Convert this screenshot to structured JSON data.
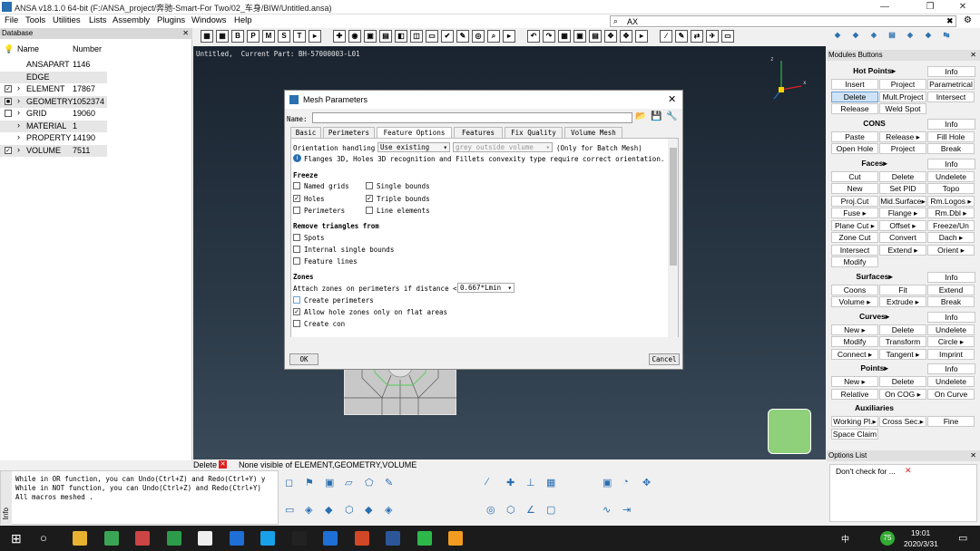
{
  "titlebar": {
    "title": "ANSA v18.1.0 64-bit (F:/ANSA_project/奔驰-Smart-For Two/02_车身/BIW/Untitled.ansa)"
  },
  "menu": [
    "File",
    "Tools",
    "Utilities",
    "Lists",
    "Assembly",
    "Plugins",
    "Windows",
    "Help"
  ],
  "search": {
    "value": "AX"
  },
  "database": {
    "header": "Database",
    "col_name": "Name",
    "col_number": "Number",
    "rows": [
      {
        "name": "ANSAPART",
        "number": "1146",
        "check": ""
      },
      {
        "name": "EDGE",
        "number": "",
        "check": ""
      },
      {
        "name": "ELEMENT",
        "number": "17867",
        "check": "✓"
      },
      {
        "name": "GEOMETRY",
        "number": "1052374",
        "check": "■"
      },
      {
        "name": "GRID",
        "number": "19060",
        "check": " "
      },
      {
        "name": "MATERIAL",
        "number": "1",
        "check": ""
      },
      {
        "name": "PROPERTY",
        "number": "14190",
        "check": ""
      },
      {
        "name": "VOLUME",
        "number": "7511",
        "check": "✓"
      }
    ]
  },
  "viewport": {
    "info": "Untitled,  Current Part: BH-57000003-L01"
  },
  "modules": {
    "header": "Modules Buttons",
    "groups": [
      {
        "title": "Hot Points▸",
        "info": "Info",
        "buttons": [
          [
            "Insert",
            "Project",
            "Parametrical"
          ],
          [
            "Delete",
            "Mult.Project",
            "Intersect"
          ],
          [
            "Release",
            "Weld Spot",
            ""
          ]
        ]
      },
      {
        "title": "CONS",
        "info": "Info",
        "buttons": [
          [
            "Paste",
            "Release ▸",
            "Fill Hole"
          ],
          [
            "Open Hole",
            "Project",
            "Break"
          ]
        ]
      },
      {
        "title": "Faces▸",
        "info": "Info",
        "buttons": [
          [
            "Cut",
            "Delete",
            "Undelete"
          ],
          [
            "New",
            "Set PID",
            "Topo"
          ],
          [
            "Proj.Cut",
            "Mid.Surface▸",
            "Rm.Logos ▸"
          ],
          [
            "Fuse ▸",
            "Flange ▸",
            "Rm.Dbl ▸"
          ],
          [
            "Plane Cut ▸",
            "Offset ▸",
            "Freeze/Un"
          ],
          [
            "Zone Cut",
            "Convert",
            "Dach ▸"
          ],
          [
            "Intersect",
            "Extend ▸",
            "Orient ▸"
          ],
          [
            "Modify",
            "",
            ""
          ]
        ]
      },
      {
        "title": "Surfaces▸",
        "info": "Info",
        "buttons": [
          [
            "Coons",
            "Fit",
            "Extend"
          ],
          [
            "Volume ▸",
            "Extrude ▸",
            "Break"
          ]
        ]
      },
      {
        "title": "Curves▸",
        "info": "Info",
        "buttons": [
          [
            "New ▸",
            "Delete",
            "Undelete"
          ],
          [
            "Modify",
            "Transform",
            "Circle ▸"
          ],
          [
            "Connect ▸",
            "Tangent ▸",
            "Imprint"
          ]
        ]
      },
      {
        "title": "Points▸",
        "info": "Info",
        "buttons": [
          [
            "New ▸",
            "Delete",
            "Undelete"
          ],
          [
            "Relative",
            "On COG ▸",
            "On Curve"
          ]
        ]
      },
      {
        "title": "Auxiliaries",
        "info": "",
        "buttons": [
          [
            "Working Pl.▸",
            "Cross Sec.▸",
            "Fine"
          ],
          [
            "Space Claim",
            "",
            ""
          ]
        ]
      }
    ]
  },
  "dialog": {
    "title": "Mesh Parameters",
    "name_label": "Name:",
    "tabs": [
      "Basic",
      "Perimeters",
      "Feature Options",
      "Features",
      "Fix Quality",
      "Volume Mesh"
    ],
    "active_tab": "Feature Options",
    "orientation_label": "Orientation handling",
    "orientation_value": "Use existing",
    "orientation_option2": "grey outside volume",
    "orientation_note": "(Only for Batch Mesh)",
    "info_line": "Flanges 3D, Holes 3D recognition and Fillets convexity type require correct orientation.",
    "freeze": {
      "title": "Freeze",
      "items": [
        {
          "label": "Named grids",
          "checked": false
        },
        {
          "label": "Single bounds",
          "checked": false
        },
        {
          "label": "Holes",
          "checked": true
        },
        {
          "label": "Triple bounds",
          "checked": true
        },
        {
          "label": "Perimeters",
          "checked": false
        },
        {
          "label": "Line elements",
          "checked": false
        }
      ]
    },
    "remove": {
      "title": "Remove triangles from",
      "items": [
        {
          "label": "Spots",
          "checked": false
        },
        {
          "label": "Internal single bounds",
          "checked": false
        },
        {
          "label": "Feature lines",
          "checked": false
        }
      ]
    },
    "zones": {
      "title": "Zones",
      "attach_label": "Attach zones on perimeters if distance <",
      "attach_value": "0.667*Lmin",
      "create_perimeters": "Create perimeters",
      "allow_hole": "Allow hole zones only on flat areas",
      "create_con": "Create con"
    },
    "ok": "OK",
    "cancel": "Cancel"
  },
  "bottom": {
    "delete_tab": "Delete",
    "status": "None visible of ELEMENT,GEOMETRY,VOLUME",
    "info_lines": [
      "While in OR function, you can Undo(Ctrl+Z) and Redo(Ctrl+Y) y",
      "While in NOT function, you can Undo(Ctrl+Z) and Redo(Ctrl+Y)",
      " All macros meshed ."
    ],
    "info_tab": "Info",
    "options_header": "Options List",
    "options_item": "Don't check for ..."
  },
  "taskbar": {
    "time": "19:01",
    "date": "2020/3/31",
    "lang": "中",
    "badge": "75"
  },
  "colors": {
    "accent": "#2a6fb0",
    "viewport_top": "#1a2430",
    "selected_btn": "#cfe3f7"
  }
}
